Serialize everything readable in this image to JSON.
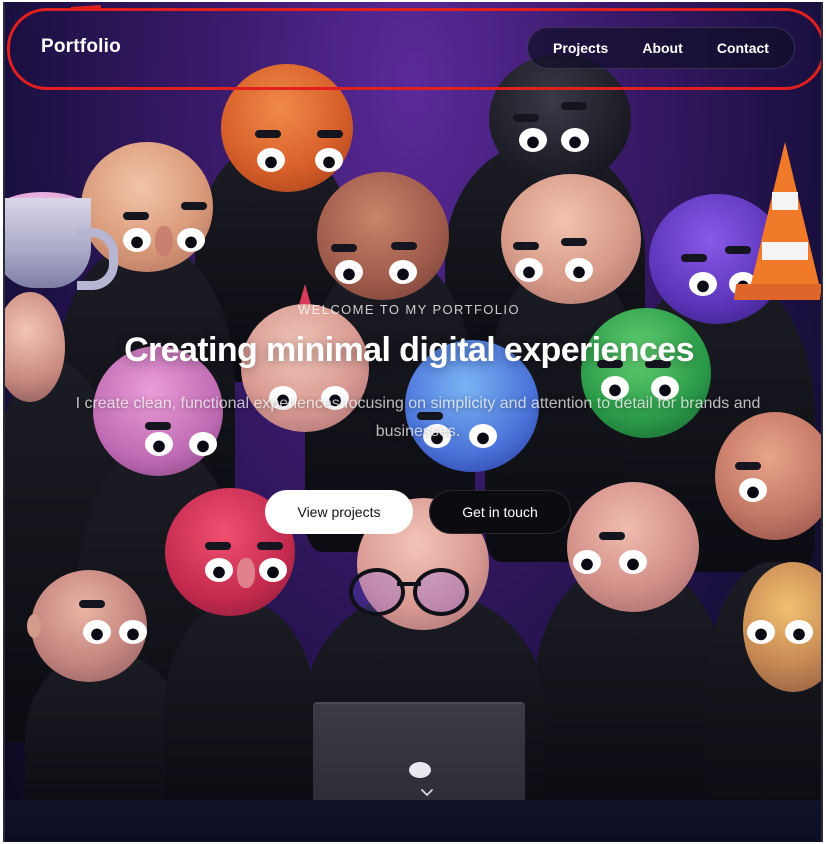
{
  "nav": {
    "brand": "Portfolio",
    "links": [
      "Projects",
      "About",
      "Contact"
    ]
  },
  "hero": {
    "eyebrow": "WELCOME TO MY PORTFOLIO",
    "title": "Creating minimal digital experiences",
    "subtitle": "I create clean, functional experiences focusing on simplicity and attention to detail for brands and businesses."
  },
  "cta": {
    "primary": "View projects",
    "secondary": "Get in touch"
  },
  "icons": {
    "scroll": "chevron-down-icon"
  },
  "colors": {
    "background_top": "#5a2a9a",
    "background_bottom": "#0b0a1c",
    "annotation": "#e0201e",
    "button_primary_bg": "#ffffff",
    "button_secondary_bg": "#0b0b10"
  }
}
